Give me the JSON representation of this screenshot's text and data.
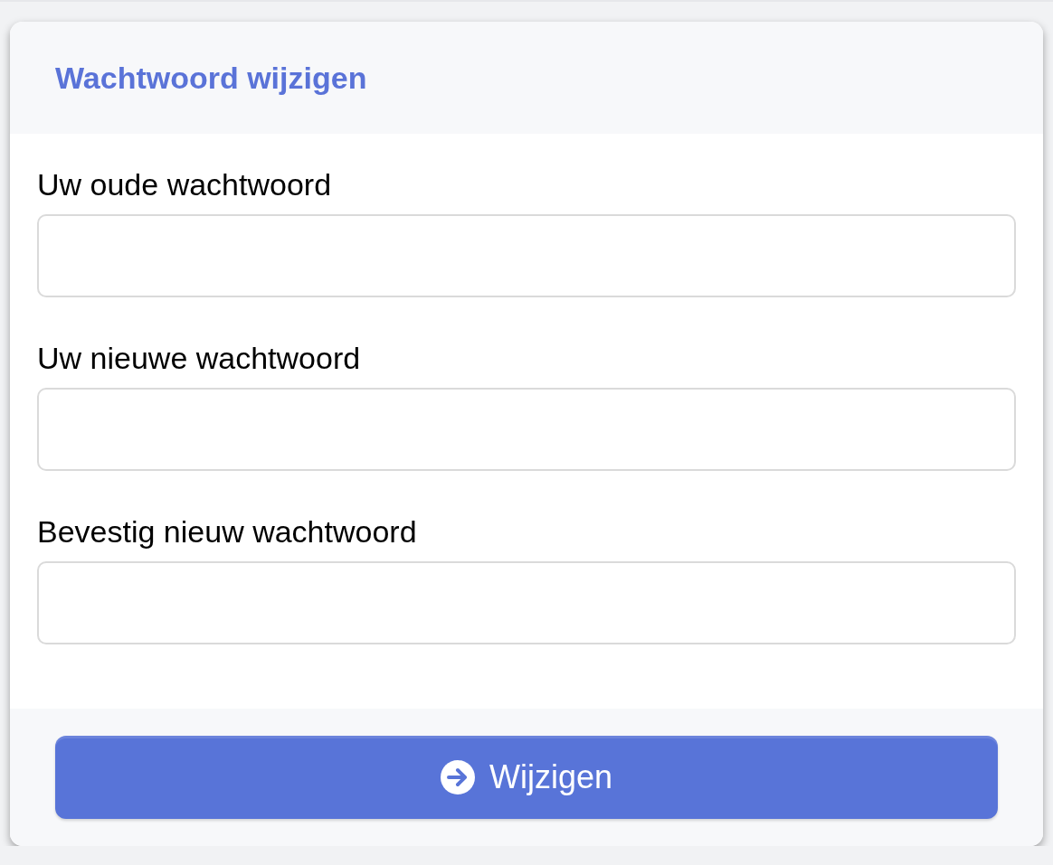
{
  "card": {
    "title": "Wachtwoord wijzigen"
  },
  "fields": [
    {
      "label": "Uw oude wachtwoord"
    },
    {
      "label": "Uw nieuwe wachtwoord"
    },
    {
      "label": "Bevestig nieuw wachtwoord"
    }
  ],
  "submit_button": {
    "label": "Wijzigen"
  }
}
